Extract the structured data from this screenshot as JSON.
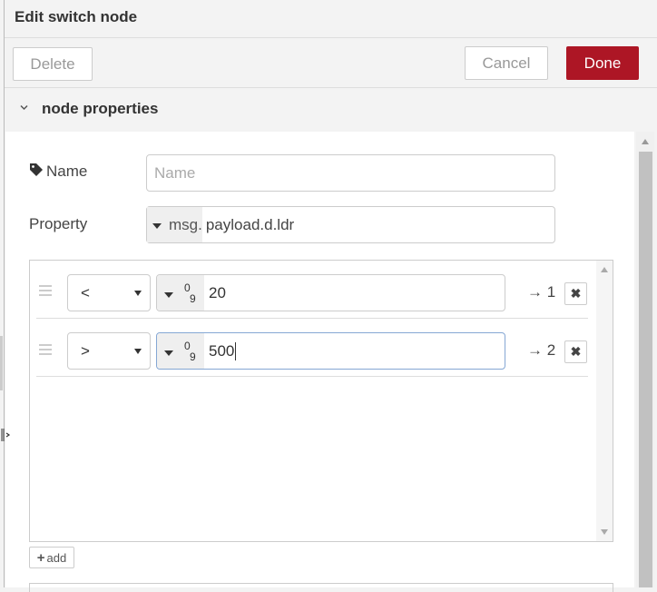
{
  "tray": {
    "title": "Edit switch node",
    "buttons": {
      "delete": "Delete",
      "cancel": "Cancel",
      "done": "Done"
    }
  },
  "section": {
    "title": "node properties",
    "expanded": true
  },
  "form": {
    "name_label": "Name",
    "name_placeholder": "Name",
    "name_value": "",
    "property_label": "Property",
    "property_type": "msg.",
    "property_value": "payload.d.ldr"
  },
  "rules": [
    {
      "operator": "<",
      "value_type": "num",
      "value": "20",
      "output": "→ 1"
    },
    {
      "operator": ">",
      "value_type": "num",
      "value": "500",
      "output": "→ 2"
    }
  ],
  "add_button": "add",
  "icons": {
    "tag": "tag-icon",
    "chevron": "chevron-down-icon",
    "number_type": "number-type-icon",
    "remove": "remove-icon",
    "drag": "drag-handle-icon",
    "plus": "plus-icon"
  },
  "colors": {
    "done_button": "#ad1625",
    "background": "#f3f3f3",
    "focus_border": "#85a7d4"
  }
}
